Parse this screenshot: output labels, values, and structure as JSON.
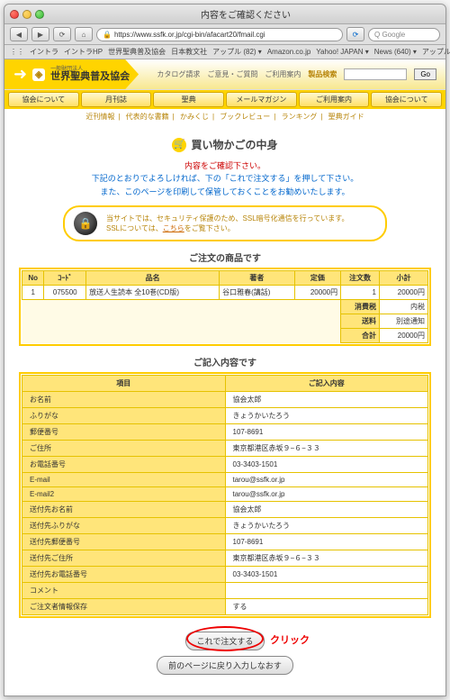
{
  "window": {
    "title": "内容をご確認ください"
  },
  "url": "https://www.ssfk.or.jp/cgi-bin/afacart20/fmail.cgi",
  "search_placeholder": "Google",
  "bookmarks": [
    "イントラ",
    "イントラHP",
    "世界聖典普及協会",
    "日本教文社",
    "アップル (82)",
    "Amazon.co.jp",
    "Yahoo! JAPAN",
    "News (640)",
    "アップル"
  ],
  "header": {
    "org_small": "一般財団法人",
    "org_large": "世界聖典普及協会",
    "right_text": "カタログ請求　ご意見・ご質問　ご利用案内",
    "search_label": "製品検索",
    "go": "Go"
  },
  "gnav": [
    "協会について",
    "月刊誌",
    "聖典",
    "メールマガジン",
    "ご利用案内",
    "協会について"
  ],
  "subnav": [
    "近刊情報",
    "代表的な書籍",
    "かみくじ",
    "ブックレビュー",
    "ランキング",
    "聖典ガイド"
  ],
  "cart": {
    "title": "買い物かごの中身"
  },
  "notice": {
    "l1": "内容をご確認下さい。",
    "l2a": "下記のとおりでよろしければ、下の",
    "l2b": "「これで注文する」",
    "l2c": "を押して下さい。",
    "l3": "また、このページを印刷して保管しておくことをお勧めいたします。"
  },
  "ssl": {
    "l1": "当サイトでは、セキュリティ保護のため、SSL暗号化通信を行っています。",
    "l2a": "SSLについては、",
    "l2b": "こちら",
    "l2c": "をご覧下さい。"
  },
  "order": {
    "head": "ご注文の商品です",
    "cols": [
      "No",
      "ｺｰﾄﾞ",
      "品名",
      "著者",
      "定価",
      "注文数",
      "小計"
    ],
    "rows": [
      {
        "no": "1",
        "code": "075500",
        "name": "放送人生読本 全10巻(CD版)",
        "author": "谷口雅春(講話)",
        "price": "20000円",
        "qty": "1",
        "sub": "20000円"
      }
    ],
    "tax_l": "消費税",
    "tax_v": "内税",
    "ship_l": "送料",
    "ship_v": "別途通知",
    "total_l": "合計",
    "total_v": "20000円"
  },
  "info": {
    "head": "ご記入内容です",
    "col1": "項目",
    "col2": "ご記入内容",
    "rows": [
      [
        "お名前",
        "協会太郎"
      ],
      [
        "ふりがな",
        "きょうかいたろう"
      ],
      [
        "郵便番号",
        "107-8691"
      ],
      [
        "ご住所",
        "東京都港区赤坂９−６−３３"
      ],
      [
        "お電話番号",
        "03-3403-1501"
      ],
      [
        "E-mail",
        "tarou@ssfk.or.jp"
      ],
      [
        "E-mail2",
        "tarou@ssfk.or.jp"
      ],
      [
        "送付先お名前",
        "協会太郎"
      ],
      [
        "送付先ふりがな",
        "きょうかいたろう"
      ],
      [
        "送付先郵便番号",
        "107-8691"
      ],
      [
        "送付先ご住所",
        "東京都港区赤坂９−６−３３"
      ],
      [
        "送付先お電話番号",
        "03-3403-1501"
      ],
      [
        "コメント",
        ""
      ],
      [
        "ご注文者情報保存",
        "する"
      ]
    ]
  },
  "buttons": {
    "submit": "これで注文する",
    "back": "前のページに戻り入力しなおす",
    "click": "クリック"
  }
}
